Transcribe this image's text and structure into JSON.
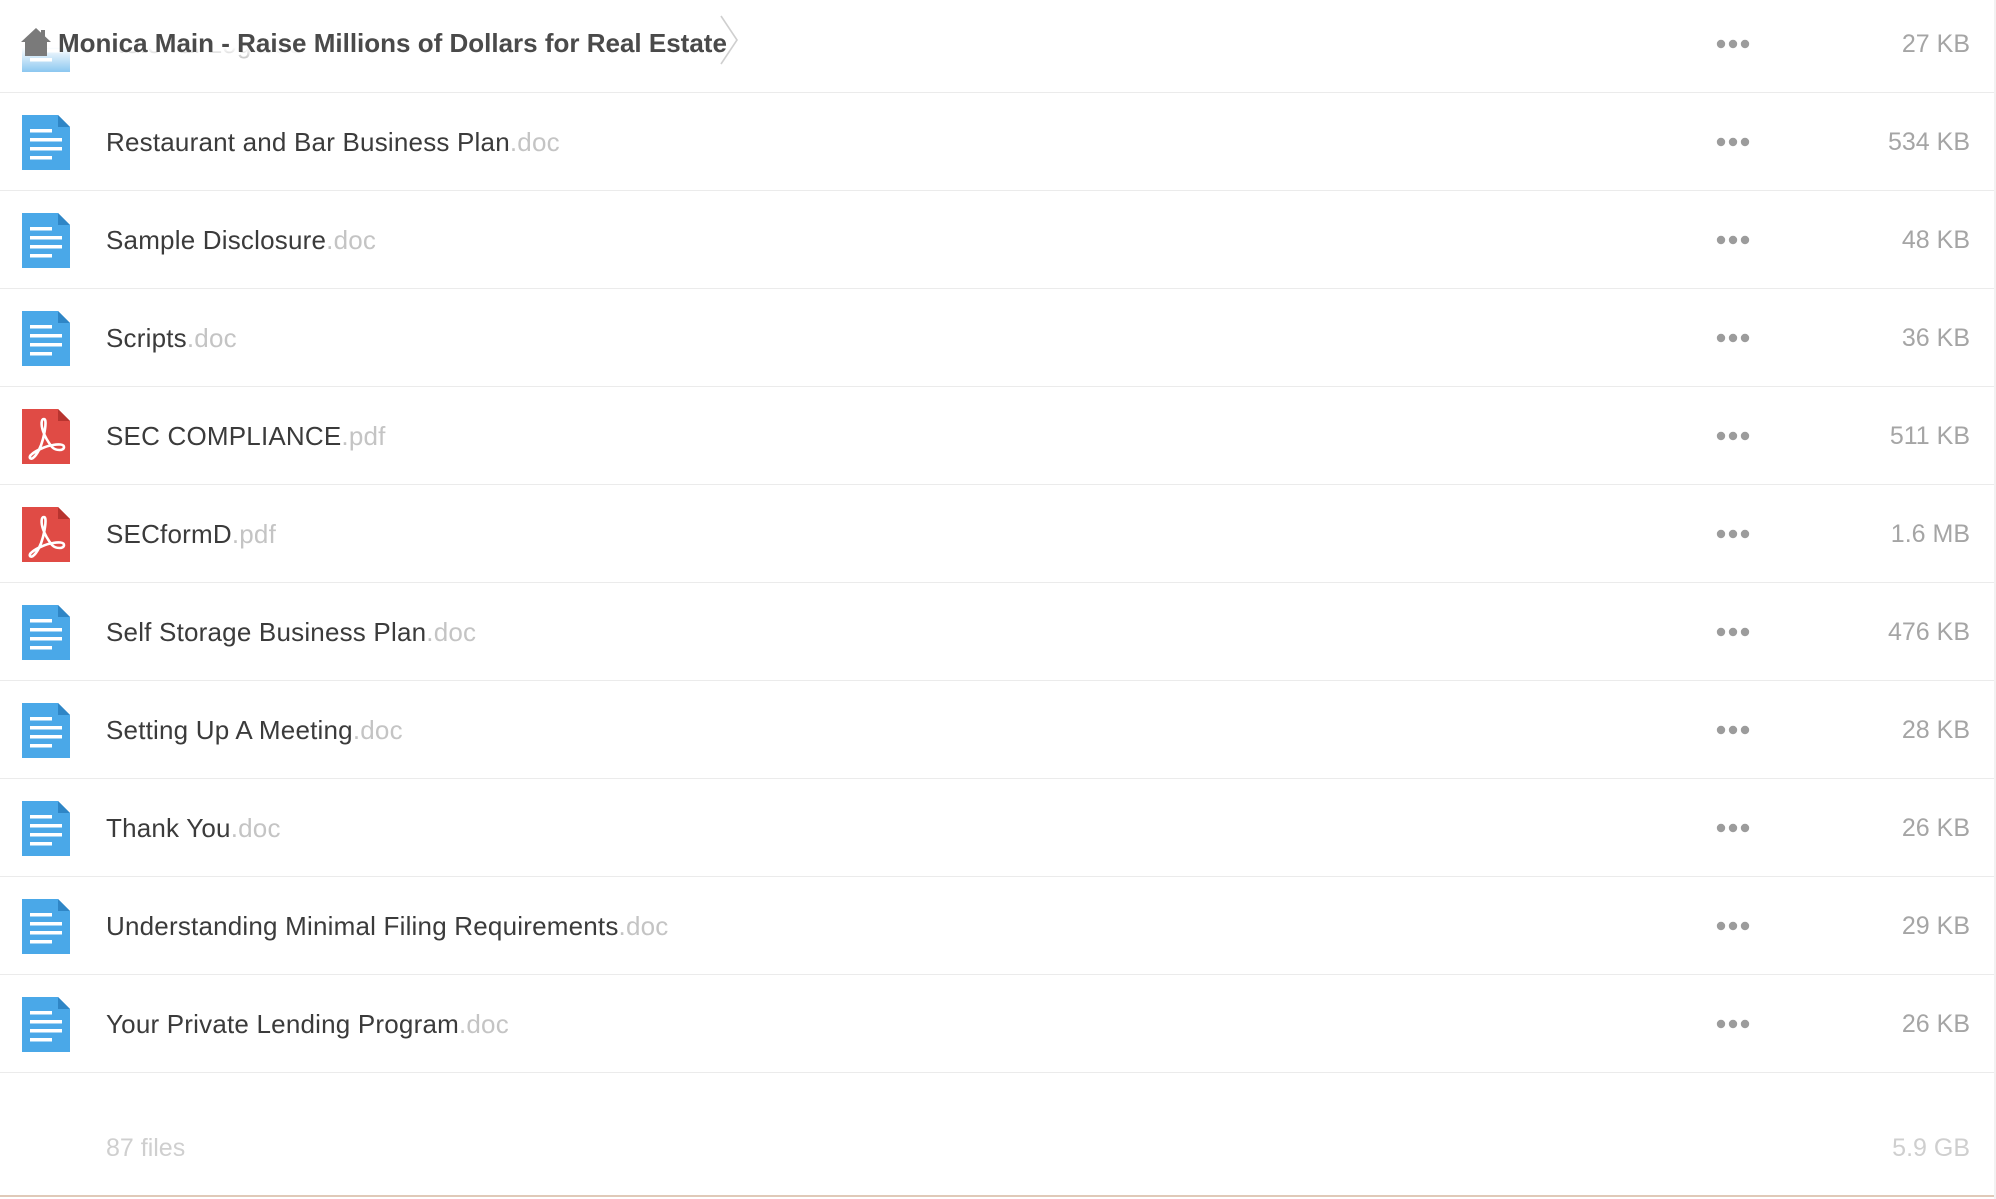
{
  "header": {
    "home_icon": "home-icon",
    "folder_title": "Monica Main - Raise Millions of Dollars for Real Estate",
    "chevron_icon": "chevron-right-icon"
  },
  "colors": {
    "doc_icon": "#4aa8e8",
    "pdf_icon": "#e04b45",
    "name_text": "#3b3b3b",
    "ext_text": "#c4c4c4",
    "size_text": "#a5a5a5",
    "dots": "#9c9c9c"
  },
  "files": [
    {
      "name": "Referral Log",
      "ext": ".doc",
      "size": "27 KB",
      "type": "doc",
      "icon": "document-icon"
    },
    {
      "name": "Restaurant and Bar Business Plan",
      "ext": ".doc",
      "size": "534 KB",
      "type": "doc",
      "icon": "document-icon"
    },
    {
      "name": "Sample Disclosure",
      "ext": ".doc",
      "size": "48 KB",
      "type": "doc",
      "icon": "document-icon"
    },
    {
      "name": "Scripts",
      "ext": ".doc",
      "size": "36 KB",
      "type": "doc",
      "icon": "document-icon"
    },
    {
      "name": "SEC COMPLIANCE",
      "ext": ".pdf",
      "size": "511 KB",
      "type": "pdf",
      "icon": "pdf-icon"
    },
    {
      "name": "SECformD",
      "ext": ".pdf",
      "size": "1.6 MB",
      "type": "pdf",
      "icon": "pdf-icon"
    },
    {
      "name": "Self Storage Business Plan",
      "ext": ".doc",
      "size": "476 KB",
      "type": "doc",
      "icon": "document-icon"
    },
    {
      "name": "Setting Up A Meeting",
      "ext": ".doc",
      "size": "28 KB",
      "type": "doc",
      "icon": "document-icon"
    },
    {
      "name": "Thank You",
      "ext": ".doc",
      "size": "26 KB",
      "type": "doc",
      "icon": "document-icon"
    },
    {
      "name": "Understanding Minimal Filing Requirements",
      "ext": ".doc",
      "size": "29 KB",
      "type": "doc",
      "icon": "document-icon"
    },
    {
      "name": "Your Private Lending Program",
      "ext": ".doc",
      "size": "26 KB",
      "type": "doc",
      "icon": "document-icon"
    }
  ],
  "more_icon": "more-dots-icon",
  "footer": {
    "file_count": "87 files",
    "total_size": "5.9 GB"
  }
}
